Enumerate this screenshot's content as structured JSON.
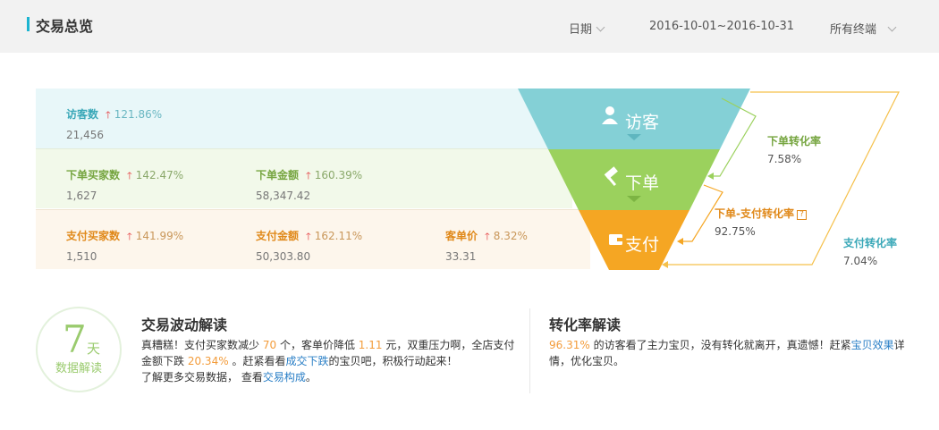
{
  "header": {
    "title": "交易总览",
    "date_label": "日期",
    "date_range": "2016-10-01~2016-10-31",
    "terminal": "所有终端"
  },
  "colors": {
    "teal": "#84d0d6",
    "green": "#9bd15d",
    "orange": "#f5a623",
    "up_arrow": "#e4393c"
  },
  "funnel": {
    "visit": {
      "label": "访客",
      "icon": "user-icon"
    },
    "order": {
      "label": "下单",
      "icon": "gavel-icon"
    },
    "pay": {
      "label": "支付",
      "icon": "wallet-icon"
    }
  },
  "metrics": {
    "visitors": {
      "label": "访客数",
      "change": "121.86%",
      "value": "21,456"
    },
    "order_buyers": {
      "label": "下单买家数",
      "change": "142.47%",
      "value": "1,627"
    },
    "order_amount": {
      "label": "下单金额",
      "change": "160.39%",
      "value": "58,347.42"
    },
    "pay_buyers": {
      "label": "支付买家数",
      "change": "141.99%",
      "value": "1,510"
    },
    "pay_amount": {
      "label": "支付金额",
      "change": "162.11%",
      "value": "50,303.80"
    },
    "unit_price": {
      "label": "客单价",
      "change": "8.32%",
      "value": "33.31"
    }
  },
  "rates": {
    "order_rate": {
      "label": "下单转化率",
      "value": "7.58%"
    },
    "order_pay_rate": {
      "label": "下单-支付转化率",
      "value": "92.75%",
      "help": "?"
    },
    "pay_rate": {
      "label": "支付转化率",
      "value": "7.04%"
    }
  },
  "badge": {
    "num": "7",
    "unit": "天",
    "sub": "数据解读"
  },
  "trade": {
    "title": "交易波动解读",
    "p1": "真糟糕！支付买家数减少",
    "v1": "70",
    "p2": "个，客单价降低",
    "v2": "1.11",
    "p3": "元，双重压力啊，全店支付金额下跌",
    "v3": "20.34%",
    "p4": "。赶紧看看",
    "link1": "成交下跌",
    "p5": "的宝贝吧，积极行动起来！",
    "p6": "了解更多交易数据，",
    "p7": "查看",
    "link2": "交易构成",
    "p8": "。"
  },
  "conversion": {
    "title": "转化率解读",
    "v1": "96.31%",
    "p1": "的访客看了主力宝贝，没有转化就离开，真遗憾！赶紧",
    "link1": "宝贝效果",
    "p2": "详情，优化宝贝。"
  }
}
